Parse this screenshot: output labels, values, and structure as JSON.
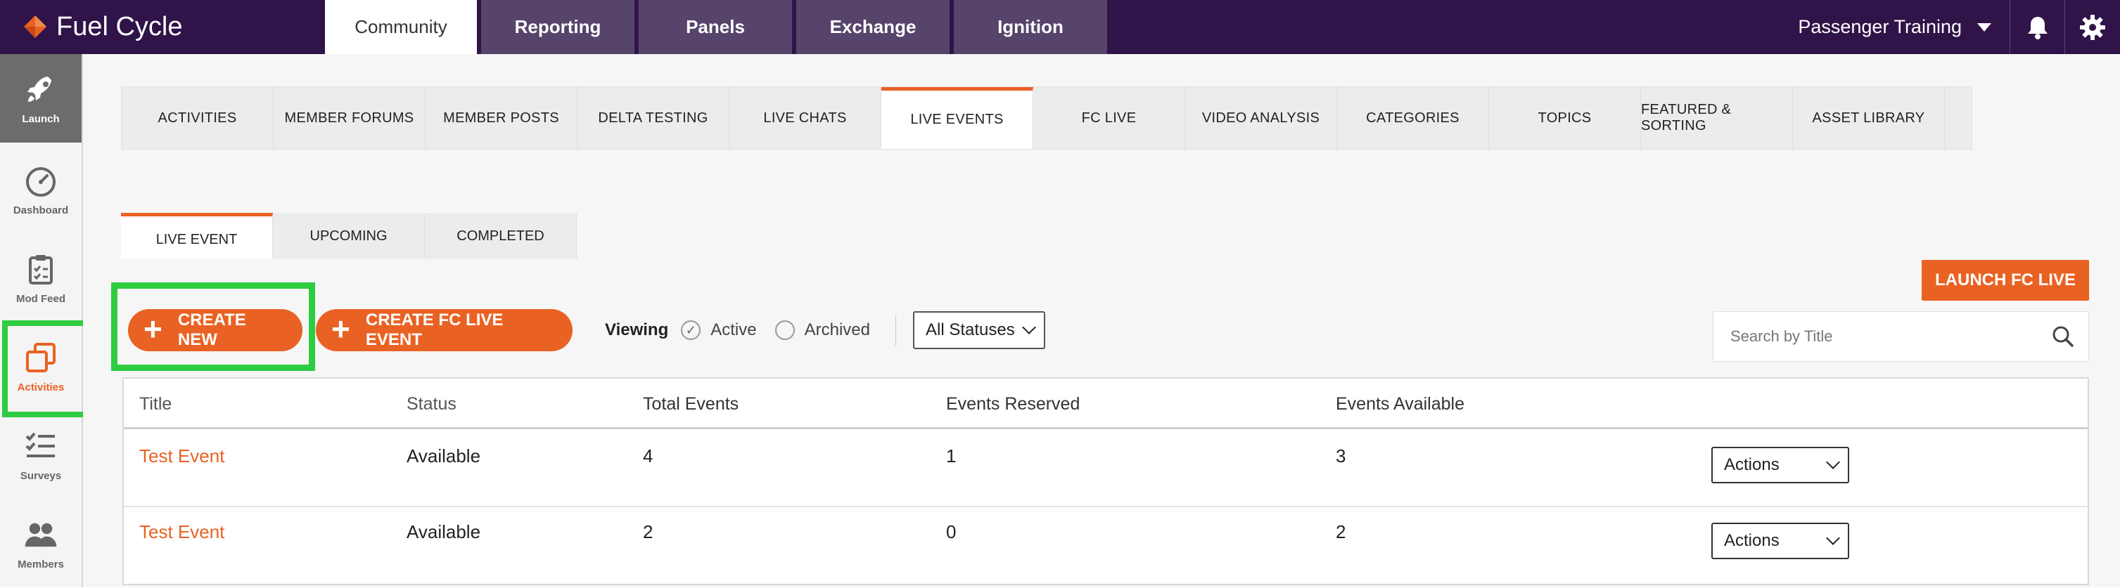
{
  "topbar": {
    "logo_text": "Fuel Cycle",
    "tabs": [
      {
        "label": "Community",
        "active": true
      },
      {
        "label": "Reporting",
        "active": false
      },
      {
        "label": "Panels",
        "active": false
      },
      {
        "label": "Exchange",
        "active": false
      },
      {
        "label": "Ignition",
        "active": false
      }
    ],
    "account_name": "Passenger Training",
    "icons": [
      "bell-icon",
      "gear-icon"
    ]
  },
  "sidebar": {
    "items": [
      {
        "label": "Launch",
        "icon": "rocket-icon"
      },
      {
        "label": "Dashboard",
        "icon": "gauge-icon"
      },
      {
        "label": "Mod Feed",
        "icon": "clipboard-icon"
      },
      {
        "label": "Activities",
        "icon": "stacked-squares-icon",
        "active": true
      },
      {
        "label": "Surveys",
        "icon": "checklist-icon"
      },
      {
        "label": "Members",
        "icon": "people-icon"
      }
    ]
  },
  "activity_tabs": [
    {
      "label": "ACTIVITIES"
    },
    {
      "label": "MEMBER FORUMS"
    },
    {
      "label": "MEMBER POSTS"
    },
    {
      "label": "DELTA TESTING"
    },
    {
      "label": "LIVE CHATS"
    },
    {
      "label": "LIVE EVENTS",
      "active": true
    },
    {
      "label": "FC LIVE"
    },
    {
      "label": "VIDEO ANALYSIS"
    },
    {
      "label": "CATEGORIES"
    },
    {
      "label": "TOPICS"
    },
    {
      "label": "FEATURED & SORTING"
    },
    {
      "label": "ASSET LIBRARY"
    }
  ],
  "sub_tabs": [
    {
      "label": "LIVE EVENT",
      "active": true
    },
    {
      "label": "UPCOMING"
    },
    {
      "label": "COMPLETED"
    }
  ],
  "toolbar": {
    "launch_fc_live": "LAUNCH FC LIVE",
    "create_new": "CREATE NEW",
    "create_fc_live_event": "CREATE FC LIVE EVENT",
    "viewing_label": "Viewing",
    "active_label": "Active",
    "active_checked": true,
    "archived_label": "Archived",
    "archived_checked": false,
    "status_select": "All Statuses",
    "search_placeholder": "Search by Title"
  },
  "table": {
    "columns": [
      "Title",
      "Status",
      "Total Events",
      "Events Reserved",
      "Events Available"
    ],
    "rows": [
      {
        "title": "Test Event",
        "status": "Available",
        "total": "4",
        "reserved": "1",
        "available": "3",
        "action": "Actions"
      },
      {
        "title": "Test Event",
        "status": "Available",
        "total": "2",
        "reserved": "0",
        "available": "2",
        "action": "Actions"
      }
    ]
  },
  "colors": {
    "brand_purple": "#2f1349",
    "accent_orange": "#e96223",
    "highlight_green": "#2ecc40"
  }
}
